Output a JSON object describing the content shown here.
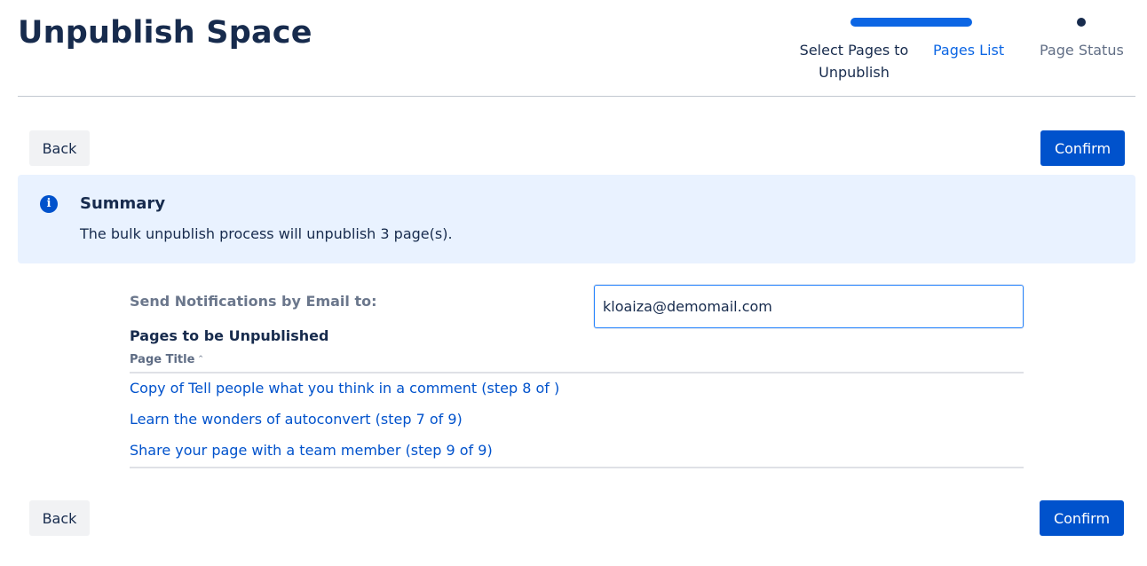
{
  "page": {
    "title": "Unpublish Space"
  },
  "tracker": {
    "steps": [
      {
        "label": "Select Pages to Unpublish",
        "state": "completed"
      },
      {
        "label": "Pages List",
        "state": "current"
      },
      {
        "label": "Page Status",
        "state": "upcoming"
      }
    ]
  },
  "actions": {
    "back_label": "Back",
    "confirm_label": "Confirm"
  },
  "summary": {
    "icon": "info-icon",
    "title": "Summary",
    "text": "The bulk unpublish process will unpublish 3 page(s)."
  },
  "notifications": {
    "label": "Send Notifications by Email to:",
    "email_value": "kloaiza@demomail.com"
  },
  "pages": {
    "heading": "Pages to be Unpublished",
    "column_header": "Page Title",
    "rows": [
      "Copy of Tell people what you think in a comment (step 8 of )",
      "Learn the wonders of autoconvert (step 7 of 9)",
      "Share your page with a team member (step 9 of 9)"
    ]
  },
  "colors": {
    "accent": "#0052cc",
    "progress": "#0c66e4",
    "summary_bg": "#e9f2ff",
    "title": "#172b4d"
  }
}
